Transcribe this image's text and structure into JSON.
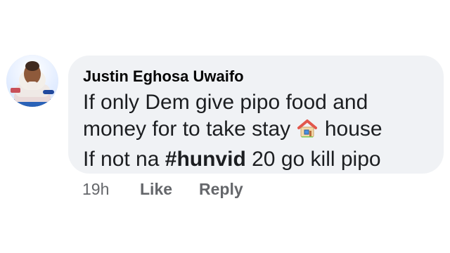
{
  "comment": {
    "author": "Justin Eghosa Uwaifo",
    "lines": [
      "If only Dem give pipo food and",
      "money for to take stay",
      "house",
      "If not na",
      "#hunvid",
      "20 go kill pipo"
    ],
    "icons": {
      "avatar": "person-avatar",
      "emoji": "house-icon"
    }
  },
  "actions": {
    "time": "19h",
    "like": "Like",
    "reply": "Reply"
  }
}
